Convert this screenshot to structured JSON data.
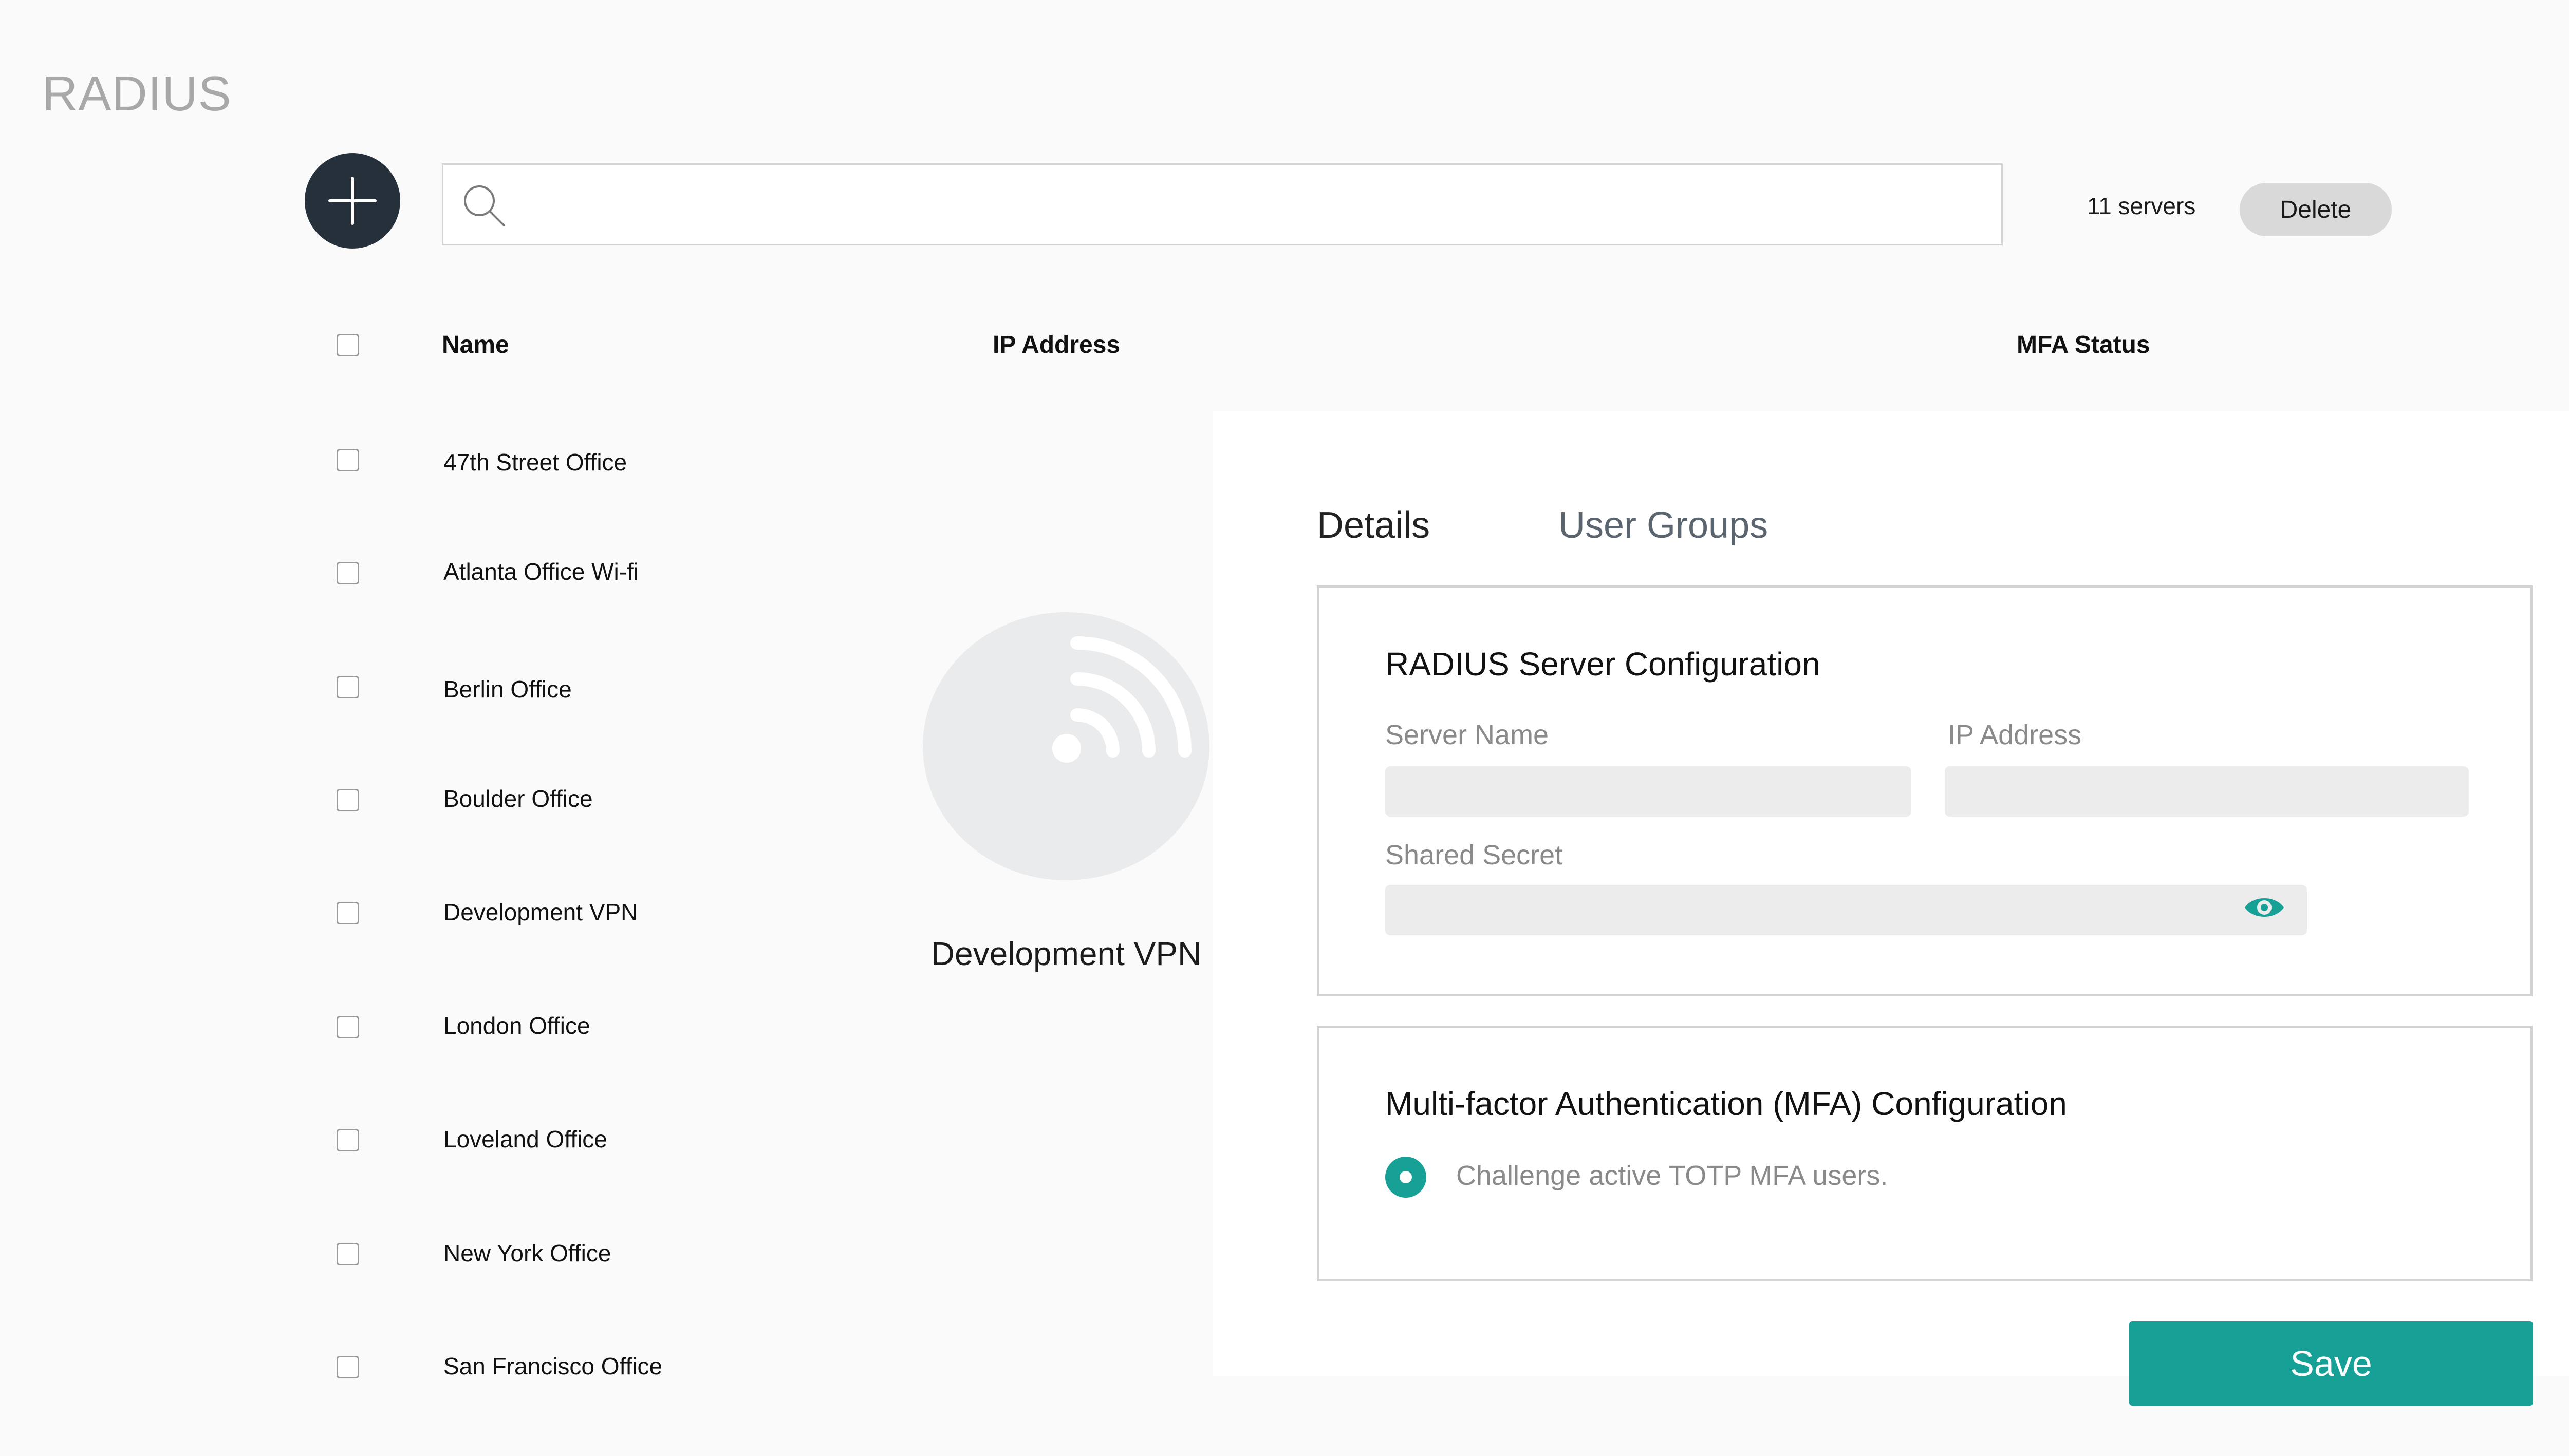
{
  "page": {
    "title": "RADIUS"
  },
  "toolbar": {
    "add_icon": "plus-icon",
    "search_icon": "search-icon",
    "search_value": "",
    "server_count": "11 servers",
    "delete_label": "Delete"
  },
  "table": {
    "columns": [
      "Name",
      "IP Address",
      "MFA Status"
    ],
    "rows": [
      "47th Street Office",
      "Atlanta Office Wi-fi",
      "Berlin Office",
      "Boulder Office",
      "Development VPN",
      "London Office",
      "Loveland Office",
      "New York Office",
      "San Francisco Office"
    ]
  },
  "detail": {
    "tabs": [
      "Details",
      "User Groups"
    ],
    "avatar_icon": "wifi-icon",
    "server_name_display": "Development VPN",
    "radius_config": {
      "title": "RADIUS Server Configuration",
      "server_name_label": "Server Name",
      "ip_address_label": "IP Address",
      "shared_secret_label": "Shared Secret",
      "server_name_value": "",
      "ip_address_value": "",
      "shared_secret_value": "",
      "reveal_icon": "eye-icon"
    },
    "mfa_config": {
      "title": "Multi-factor Authentication (MFA) Configuration",
      "option_label": "Challenge active TOTP MFA users.",
      "option_selected": true
    },
    "save_label": "Save"
  },
  "colors": {
    "accent": "#17a096",
    "dark_button": "#25303b",
    "title_gray": "#a8a8a8",
    "input_bg": "#ececec"
  }
}
